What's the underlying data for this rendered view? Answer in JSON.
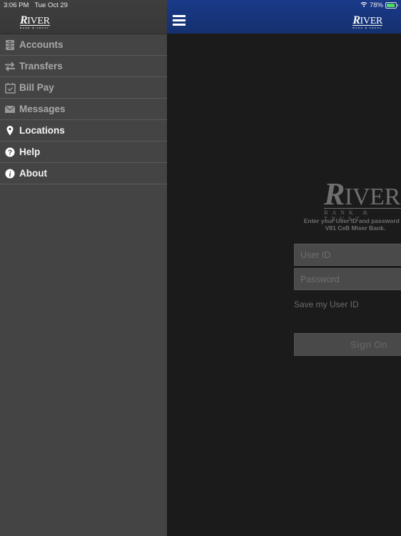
{
  "status_bar": {
    "time": "3:06 PM",
    "date": "Tue Oct 29",
    "battery": "78%",
    "battery_level": 0.78
  },
  "brand": {
    "logo_main_initial": "R",
    "logo_main_rest": "IVER",
    "logo_sub": "BANK & TRUST"
  },
  "sidebar": {
    "items": [
      {
        "label": "Accounts",
        "icon": "accounts-icon",
        "state": "dim"
      },
      {
        "label": "Transfers",
        "icon": "transfers-icon",
        "state": "dim"
      },
      {
        "label": "Bill Pay",
        "icon": "calendar-icon",
        "state": "dim"
      },
      {
        "label": "Messages",
        "icon": "envelope-icon",
        "state": "dim"
      },
      {
        "label": "Locations",
        "icon": "map-pin-icon",
        "state": "bright"
      },
      {
        "label": "Help",
        "icon": "help-icon",
        "state": "bright"
      },
      {
        "label": "About",
        "icon": "info-icon",
        "state": "bright"
      }
    ]
  },
  "login": {
    "instruction_line1": "Enter your User ID and password to",
    "instruction_line2": "V81 CeB Miser Bank.",
    "userid_placeholder": "User ID",
    "password_placeholder": "Password",
    "save_label": "Save my User ID",
    "signon_label": "Sign On"
  },
  "colors": {
    "navbar": "#1a3a8a",
    "sidebar": "#444444",
    "content_bg": "#1b1b1b"
  }
}
